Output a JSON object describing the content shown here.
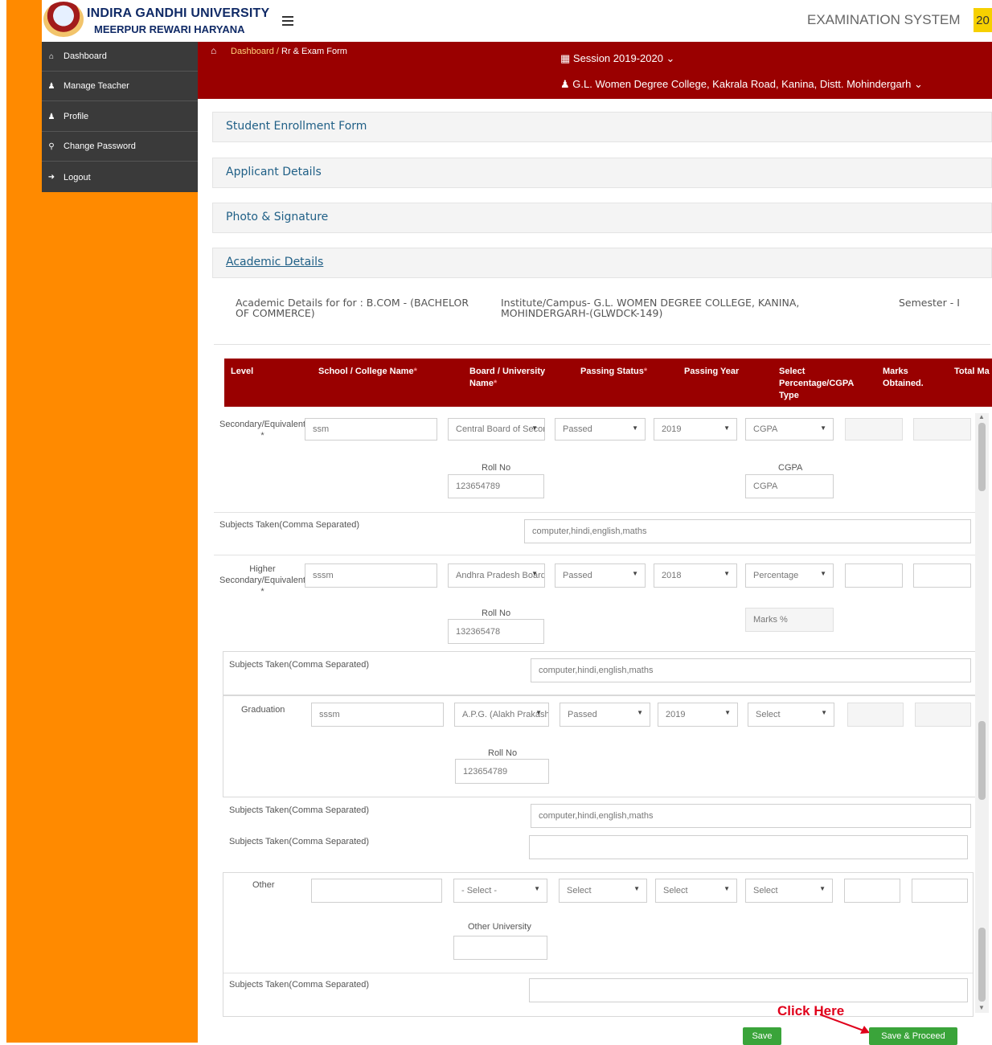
{
  "header": {
    "university_name": "INDIRA GANDHI UNIVERSITY",
    "university_location": "MEERPUR REWARI HARYANA",
    "system_title": "EXAMINATION SYSTEM",
    "year_badge": "20"
  },
  "sidebar": {
    "items": [
      {
        "label": "Dashboard",
        "icon": "home-icon"
      },
      {
        "label": "Manage Teacher",
        "icon": "user-add-icon"
      },
      {
        "label": "Profile",
        "icon": "users-icon"
      },
      {
        "label": "Change Password",
        "icon": "key-icon"
      },
      {
        "label": "Logout",
        "icon": "logout-icon"
      }
    ]
  },
  "breadcrumb": {
    "root": "Dashboard",
    "separator": " / ",
    "current": "Rr & Exam Form"
  },
  "session": {
    "label": "Session  2019-2020"
  },
  "college": {
    "label": "G.L. Women Degree College, Kakrala Road, Kanina, Distt. Mohindergarh"
  },
  "panels": {
    "student_enrollment": "Student Enrollment Form",
    "applicant_details": "Applicant Details",
    "photo_signature": "Photo & Signature",
    "academic_details": "Academic Details"
  },
  "info": {
    "course": "Academic Details for for : B.COM - (BACHELOR OF COMMERCE)",
    "institute": "Institute/Campus- G.L. WOMEN DEGREE COLLEGE, KANINA, MOHINDERGARH-(GLWDCK-149)",
    "semester": "Semester - I"
  },
  "table_headers": {
    "level": "Level",
    "school": "School / College Name",
    "board": "Board / University Name",
    "passing_status": "Passing Status",
    "passing_year": "Passing Year",
    "select_type": "Select Percentage/CGPA Type",
    "marks_obtained": "Marks Obtained.",
    "total_marks": "Total Ma",
    "required_mark": "*"
  },
  "rows": {
    "secondary": {
      "level": "Secondary/Equivalent *",
      "school": "ssm",
      "board": "Central Board of Secondary",
      "status": "Passed",
      "year": "2019",
      "type": "CGPA",
      "roll_label": "Roll No",
      "roll_value": "123654789",
      "score_label": "CGPA",
      "score_placeholder": "CGPA",
      "subjects_label": "Subjects Taken(Comma Separated)",
      "subjects": "computer,hindi,english,maths"
    },
    "higher_secondary": {
      "level": "Higher Secondary/Equivalent *",
      "school": "sssm",
      "board": "Andhra Pradesh Board",
      "status": "Passed",
      "year": "2018",
      "type": "Percentage",
      "roll_label": "Roll No",
      "roll_value": "132365478",
      "score_placeholder": "Marks %",
      "subjects_label": "Subjects Taken(Comma Separated)",
      "subjects": "computer,hindi,english,maths"
    },
    "graduation": {
      "level": "Graduation",
      "school": "sssm",
      "board": "A.P.G. (Alakh Prakash Goyal)",
      "status": "Passed",
      "year": "2019",
      "type": "Select",
      "roll_label": "Roll No",
      "roll_value": "123654789",
      "subjects_label": "Subjects Taken(Comma Separated)",
      "subjects": "computer,hindi,english,maths",
      "subjects_label_2": "Subjects Taken(Comma Separated)",
      "subjects_2": ""
    },
    "other": {
      "level": "Other",
      "school": "",
      "board": "- Select -",
      "status": "Select",
      "year": "Select",
      "type": "Select",
      "other_university_label": "Other University",
      "subjects_label": "Subjects Taken(Comma Separated)",
      "subjects": ""
    }
  },
  "buttons": {
    "save": "Save",
    "save_proceed": "Save & Proceed"
  },
  "annotation": {
    "text": "Click Here",
    "color": "#e0001b"
  },
  "colors": {
    "sidebar_bg": "#ff8a00",
    "topbar_accent": "#9a0000",
    "button_green": "#3aa43a"
  }
}
